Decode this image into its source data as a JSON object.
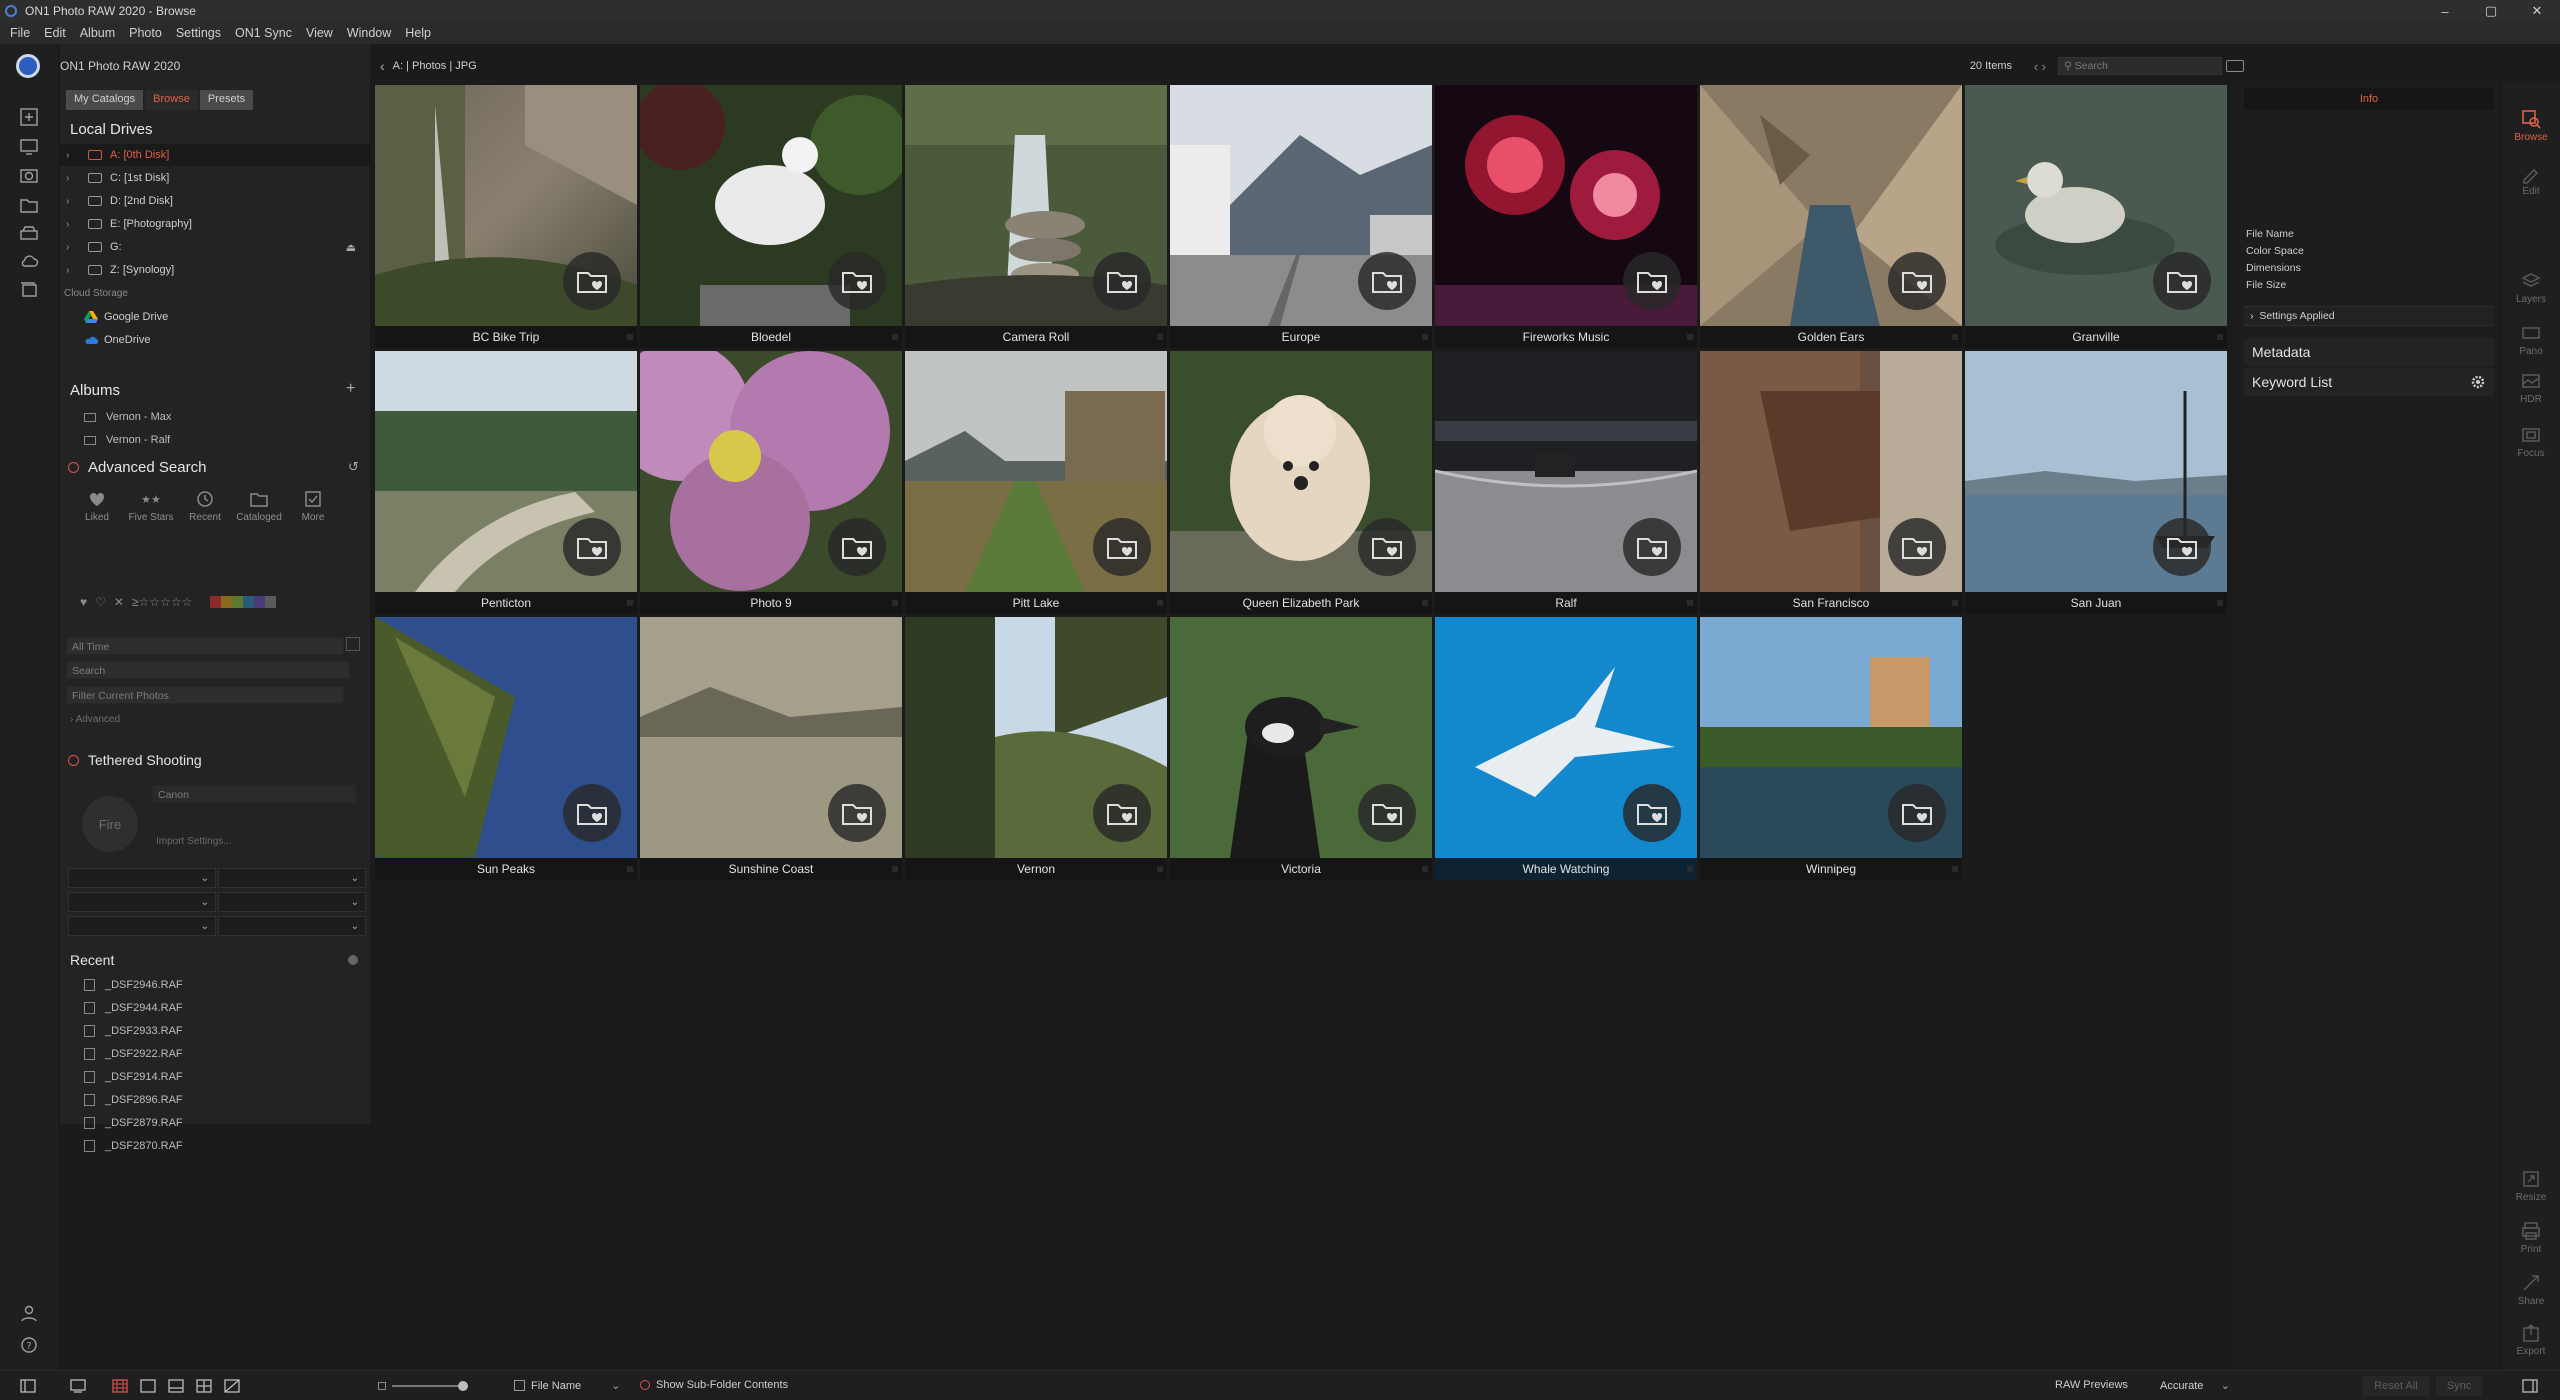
{
  "window": {
    "title": "ON1 Photo RAW 2020 - Browse",
    "controls": [
      "–",
      "▢",
      "✕"
    ]
  },
  "menu": [
    "File",
    "Edit",
    "Album",
    "Photo",
    "Settings",
    "ON1 Sync",
    "View",
    "Window",
    "Help"
  ],
  "left": {
    "app_name": "ON1 Photo RAW 2020",
    "tabs": [
      "My Catalogs",
      "Browse",
      "Presets"
    ],
    "local_drives_title": "Local Drives",
    "drives": [
      "A: [0th Disk]",
      "C: [1st Disk]",
      "D: [2nd Disk]",
      "E: [Photography]",
      "G:",
      "Z: [Synology]"
    ],
    "cloud_storage_label": "Cloud Storage",
    "cloud": [
      "Google Drive",
      "OneDrive"
    ],
    "albums_title": "Albums",
    "albums": [
      "Vernon - Max",
      "Vernon - Ralf"
    ],
    "advanced_search_title": "Advanced Search",
    "search_filters": [
      "Liked",
      "Five Stars",
      "Recent",
      "Cataloged",
      "More"
    ],
    "rating_prefix": "≥☆☆☆☆☆",
    "swatch_colors": [
      "#8b2a2a",
      "#8a6a1f",
      "#5d7a2a",
      "#2a5a7a",
      "#4a3a7a",
      "#5a5a5a"
    ],
    "time_field": "All Time",
    "search_placeholder": "Search",
    "filter_placeholder": "Filter Current Photos",
    "advanced_label": "Advanced",
    "tethered_title": "Tethered Shooting",
    "camera_field": "Canon",
    "fire_label": "Fire",
    "import_settings": "Import Settings...",
    "recent_title": "Recent",
    "recent_files": [
      "_DSF2946.RAF",
      "_DSF2944.RAF",
      "_DSF2933.RAF",
      "_DSF2922.RAF",
      "_DSF2914.RAF",
      "_DSF2896.RAF",
      "_DSF2879.RAF",
      "_DSF2870.RAF"
    ]
  },
  "path": {
    "location": "A: | Photos | JPG",
    "items_count": "20 Items",
    "search_placeholder": "Search"
  },
  "folders": [
    "BC Bike Trip",
    "Bloedel",
    "Camera Roll",
    "Europe",
    "Fireworks Music",
    "Golden Ears",
    "Granville",
    "Penticton",
    "Photo 9",
    "Pitt Lake",
    "Queen Elizabeth Park",
    "Ralf",
    "San Francisco",
    "San Juan",
    "Sun Peaks",
    "Sunshine Coast",
    "Vernon",
    "Victoria",
    "Whale Watching",
    "Winnipeg"
  ],
  "info_panel": {
    "tab": "Info",
    "fields": [
      "File Name",
      "Color Space",
      "Dimensions",
      "File Size"
    ],
    "settings_applied": "Settings Applied",
    "metadata": "Metadata",
    "keyword_list": "Keyword List"
  },
  "right_tools": [
    "Browse",
    "Edit",
    "Layers",
    "Pano",
    "HDR",
    "Focus",
    "Resize",
    "Print",
    "Share",
    "Export"
  ],
  "bottom": {
    "sort_label": "File Name",
    "subfolder_label": "Show Sub-Folder Contents",
    "raw_previews_label": "RAW Previews",
    "raw_previews_value": "Accurate",
    "reset_all": "Reset All",
    "sync": "Sync"
  },
  "accent_color": "#e0614a"
}
